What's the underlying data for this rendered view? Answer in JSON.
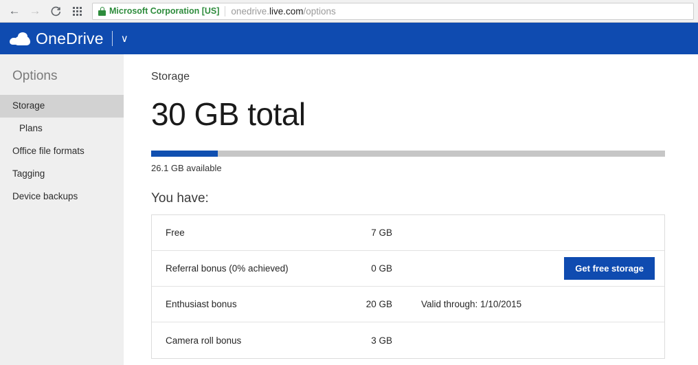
{
  "browser": {
    "back_icon": "back-arrow-icon",
    "forward_icon": "forward-arrow-icon",
    "reload_icon": "reload-icon",
    "apps_icon": "apps-grid-icon",
    "lock_icon": "lock-icon",
    "ev_certificate_name": "Microsoft Corporation [US]",
    "url_prefix": "onedrive.",
    "url_host": "live.com",
    "url_path": "/options",
    "reload_glyph": "⟳",
    "back_glyph": "←",
    "forward_glyph": "→"
  },
  "header": {
    "brand": "OneDrive",
    "cloud_icon": "onedrive-cloud-icon",
    "chevron_glyph": "∨",
    "background_color": "#0f4bb0"
  },
  "sidebar": {
    "title": "Options",
    "items": [
      {
        "label": "Storage",
        "selected": true,
        "sub": false
      },
      {
        "label": "Plans",
        "selected": false,
        "sub": true
      },
      {
        "label": "Office file formats",
        "selected": false,
        "sub": false
      },
      {
        "label": "Tagging",
        "selected": false,
        "sub": false
      },
      {
        "label": "Device backups",
        "selected": false,
        "sub": false
      }
    ]
  },
  "main": {
    "breadcrumb": "Storage",
    "total_heading": "30 GB total",
    "meter": {
      "available_label": "26.1 GB available",
      "fill_percent": 13,
      "fill_color": "#104fb0",
      "track_color": "#c6c6c6"
    },
    "section_title": "You have:",
    "table": {
      "rows": [
        {
          "name": "Free",
          "size": "7 GB",
          "note": "",
          "action": ""
        },
        {
          "name": "Referral bonus (0% achieved)",
          "size": "0 GB",
          "note": "",
          "action": "Get free storage"
        },
        {
          "name": "Enthusiast bonus",
          "size": "20 GB",
          "note": "Valid through: 1/10/2015",
          "action": ""
        },
        {
          "name": "Camera roll bonus",
          "size": "3 GB",
          "note": "",
          "action": ""
        }
      ]
    }
  }
}
